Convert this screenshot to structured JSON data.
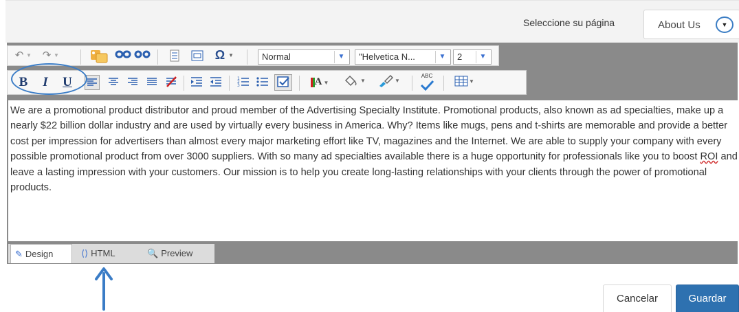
{
  "page_selector": {
    "label": "Seleccione su página",
    "value": "About Us",
    "arrow_glyph": "▼"
  },
  "toolbar": {
    "undo_glyph": "↶",
    "redo_glyph": "↷",
    "paragraph_style": "Normal",
    "font_family": "\"Helvetica N...",
    "font_size": "2",
    "bold_label": "B",
    "italic_label": "I",
    "underline_label": "U",
    "spellcheck_label": "ABC",
    "omega_glyph": "Ω",
    "text_color_label": "A"
  },
  "content": {
    "text_before_roi": "We are a promotional product distributor and proud member of the Advertising Specialty Institute. Promotional products, also known as ad specialties, make up a nearly $22 billion dollar industry and are used by virtually every business in America. Why? Items like mugs, pens and t-shirts are memorable and provide a better cost per impression for advertisers than almost every major marketing effort like TV, magazines and the Internet. We are able to supply your company with every possible promotional product from over 3000 suppliers. With so many ad specialties available there is a huge opportunity for professionals like you to boost ",
    "roi": "ROI",
    "text_after_roi": " and leave a lasting impression with your customers. Our mission is to help you create long-lasting relationships with your clients through the power of promotional products."
  },
  "tabs": [
    {
      "label": "Design",
      "icon": "pencil-icon"
    },
    {
      "label": "HTML",
      "icon": "code-icon"
    },
    {
      "label": "Preview",
      "icon": "magnifier-icon"
    }
  ],
  "actions": {
    "cancel": "Cancelar",
    "save": "Guardar"
  },
  "colors": {
    "accent": "#2e71b0",
    "annotation": "#3a7cc6",
    "editor_frame": "#8a8a8a"
  }
}
